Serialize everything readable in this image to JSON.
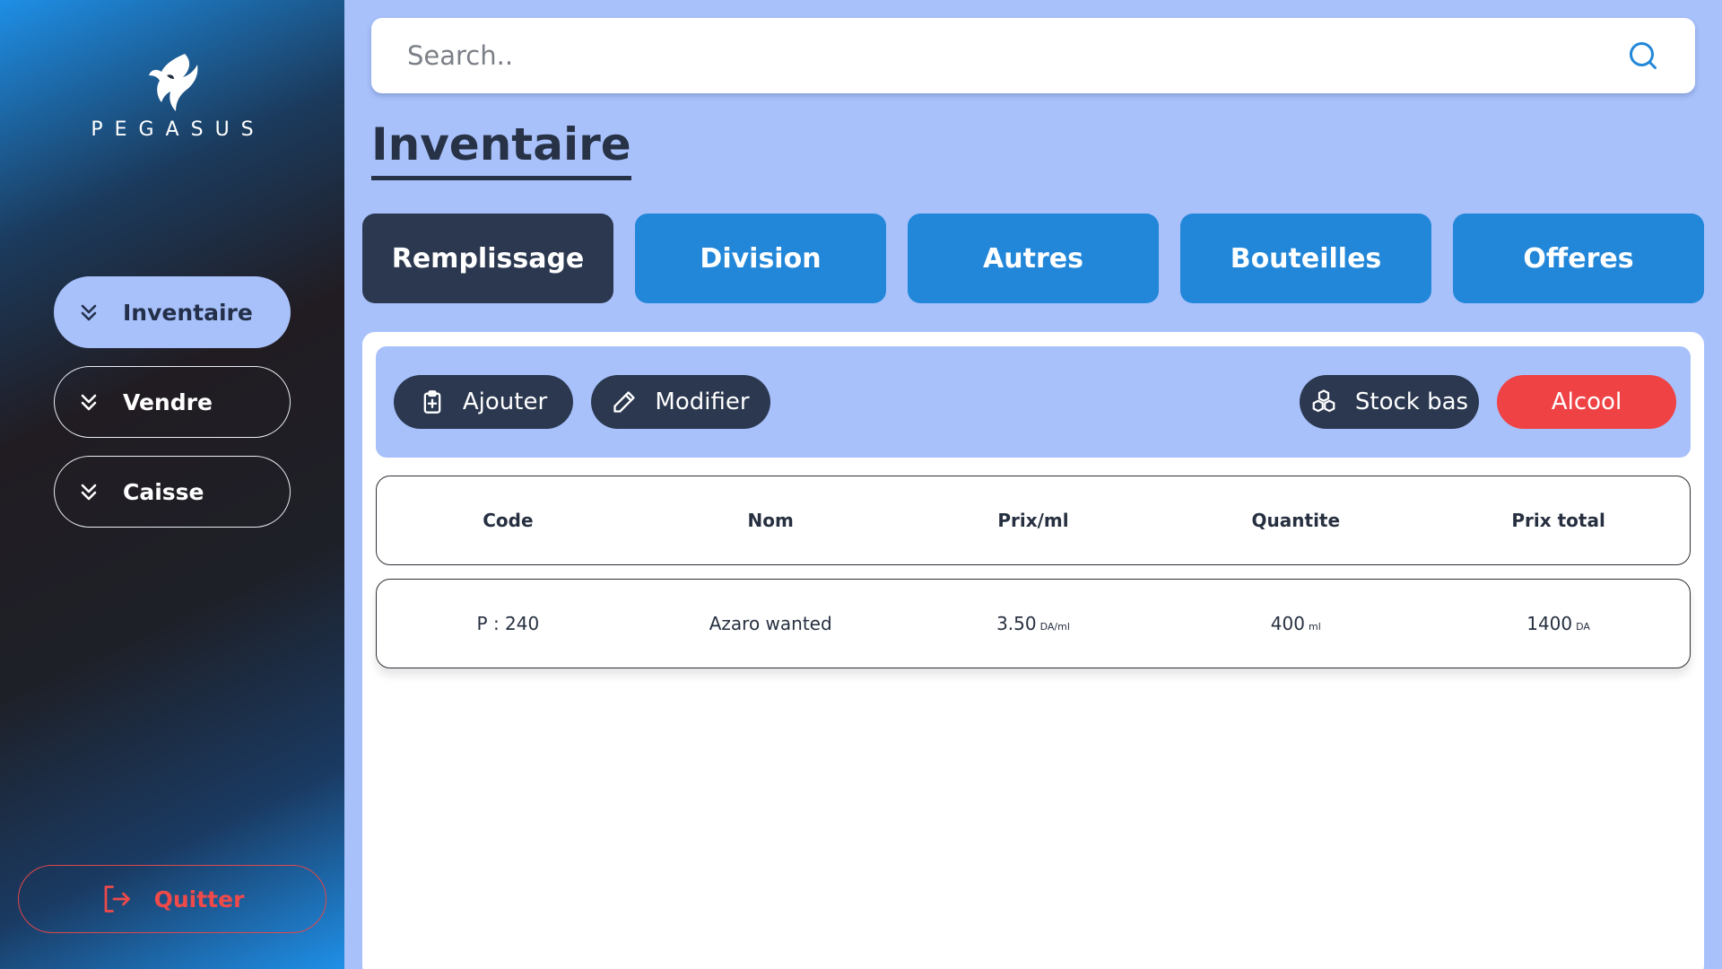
{
  "sidebar": {
    "logo_text": "PEGASUS",
    "items": [
      {
        "label": "Inventaire",
        "active": true
      },
      {
        "label": "Vendre",
        "active": false
      },
      {
        "label": "Caisse",
        "active": false
      }
    ],
    "quit_label": "Quitter"
  },
  "search": {
    "placeholder": "Search.."
  },
  "page_title": "Inventaire",
  "tabs": [
    {
      "label": "Remplissage",
      "active": true
    },
    {
      "label": "Division",
      "active": false
    },
    {
      "label": "Autres",
      "active": false
    },
    {
      "label": "Bouteilles",
      "active": false
    },
    {
      "label": "Offeres",
      "active": false
    }
  ],
  "toolbar": {
    "add_label": "Ajouter",
    "edit_label": "Modifier",
    "low_stock_label": "Stock bas",
    "alcohol_label": "Alcool"
  },
  "table": {
    "columns": [
      "Code",
      "Nom",
      "Prix/ml",
      "Quantite",
      "Prix total"
    ],
    "rows": [
      {
        "code": "P : 240",
        "name": "Azaro wanted",
        "price": "3.50",
        "price_unit": "DA/ml",
        "quantity": "400",
        "quantity_unit": "ml",
        "total": "1400",
        "total_unit": "DA"
      }
    ]
  },
  "colors": {
    "background": "#a8c1fb",
    "tab_blue": "#2287d9",
    "dark_navy": "#2b3850",
    "alert_red": "#ef4245"
  },
  "icons": {
    "search": "search-icon",
    "nav": "chevrons-down-icon",
    "quit": "logout-icon",
    "add": "clipboard-plus-icon",
    "edit": "pencil-icon",
    "low_stock": "boxes-icon",
    "logo": "pegasus-logo"
  }
}
